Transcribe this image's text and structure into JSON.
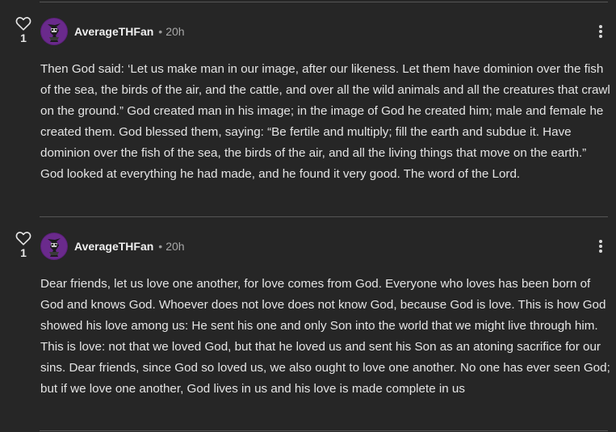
{
  "comments": [
    {
      "likes": "1",
      "author": "AverageTHFan",
      "separator": "•",
      "time": "20h",
      "text": "Then God said: ‘Let us make man in our image, after our likeness. Let them have dominion over the fish of the sea, the birds of the air, and the cattle, and over all the wild animals and all the creatures that crawl on the ground.” God created man in his image; in the image of God he created him; male and female he created them. God blessed them, saying: “Be fertile and multiply; fill the earth and subdue it. Have dominion over the fish of the sea, the birds of the air, and all the living things that move on the earth.” God looked at everything he had made, and he found it very good. The word of the Lord."
    },
    {
      "likes": "1",
      "author": "AverageTHFan",
      "separator": "•",
      "time": "20h",
      "text": "Dear friends, let us love one another, for love comes from God. Everyone who loves has been born of God and knows God. Whoever does not love does not know God, because God is love. This is how God showed his love among us: He sent his one and only Son into the world that we might live through him. This is love: not that we loved God, but that he loved us and sent his Son as an atoning sacrifice for our sins. Dear friends, since God so loved us, we also ought to love one another. No one has ever seen God; but if we love one another, God lives in us and his love is made complete in us"
    }
  ],
  "icons": {
    "like": "heart-icon",
    "more": "more-vertical-icon",
    "avatar": "user-avatar"
  },
  "colors": {
    "background": "#262626",
    "text": "#e4e4e4",
    "muted": "#a8a8a8",
    "divider": "#555555",
    "avatar_purple": "#5b1f7a"
  }
}
